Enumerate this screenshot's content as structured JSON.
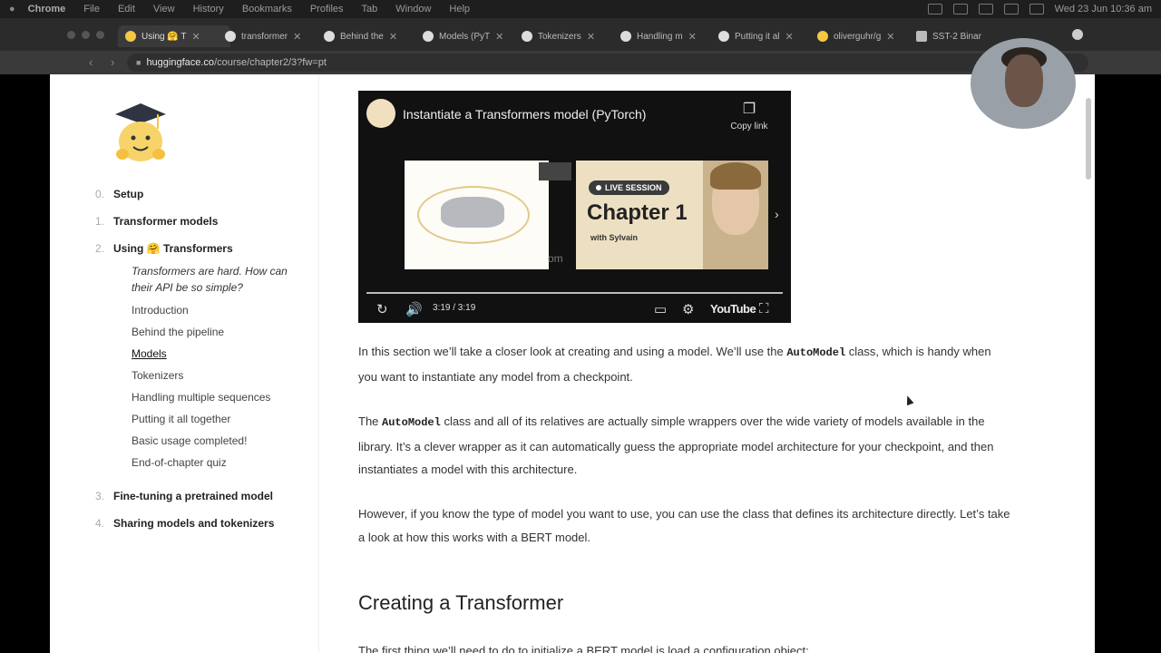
{
  "menubar": {
    "items": [
      "Chrome",
      "File",
      "Edit",
      "View",
      "History",
      "Bookmarks",
      "Profiles",
      "Tab",
      "Window",
      "Help"
    ],
    "datetime": "Wed 23 Jun  10:36 am"
  },
  "tabs": [
    {
      "label": "Using 🤗 T",
      "active": true
    },
    {
      "label": "transformer"
    },
    {
      "label": "Behind the"
    },
    {
      "label": "Models (PyT"
    },
    {
      "label": "Tokenizers"
    },
    {
      "label": "Handling m"
    },
    {
      "label": "Putting it al"
    },
    {
      "label": "oliverguhr/g"
    },
    {
      "label": "SST-2 Binar"
    }
  ],
  "address": {
    "host": "huggingface.co",
    "path": "/course/chapter2/3?fw=pt"
  },
  "sidebar": {
    "chapters": [
      {
        "num": "0.",
        "label": "Setup"
      },
      {
        "num": "1.",
        "label": "Transformer models"
      },
      {
        "num": "2.",
        "label": "Using 🤗 Transformers"
      },
      {
        "num": "3.",
        "label": "Fine-tuning a pretrained model"
      },
      {
        "num": "4.",
        "label": "Sharing models and tokenizers"
      }
    ],
    "tagline": "Transformers are hard. How can their API be so simple?",
    "sections": [
      "Introduction",
      "Behind the pipeline",
      "Models",
      "Tokenizers",
      "Handling multiple sequences",
      "Putting it all together",
      "Basic usage completed!",
      "End-of-chapter quiz"
    ]
  },
  "video": {
    "title": "Instantiate a Transformers model (PyTorch)",
    "copy_link": "Copy link",
    "live_session": "LIVE SESSION",
    "chapter": "Chapter 1",
    "with": "with Sylvain",
    "om": "om",
    "time": "3:19 / 3:19",
    "youtube": "YouTube",
    "progress": 1.0
  },
  "content": {
    "p1_a": "In this section we’ll take a closer look at creating and using a model. We’ll use the ",
    "p1_code": "AutoModel",
    "p1_b": " class, which is handy when you want to instantiate any model from a checkpoint.",
    "p2_a": "The ",
    "p2_code": "AutoModel",
    "p2_b": " class and all of its relatives are actually simple wrappers over the wide variety of models available in the library. It’s a clever wrapper as it can automatically guess the appropriate model architecture for your checkpoint, and then instantiates a model with this architecture.",
    "p3": "However, if you know the type of model you want to use, you can use the class that defines its architecture directly. Let’s take a look at how this works with a BERT model.",
    "heading": "Creating a Transformer",
    "cutoff": "The first thing we’ll need to do to initialize a BERT model is load a configuration object:"
  }
}
